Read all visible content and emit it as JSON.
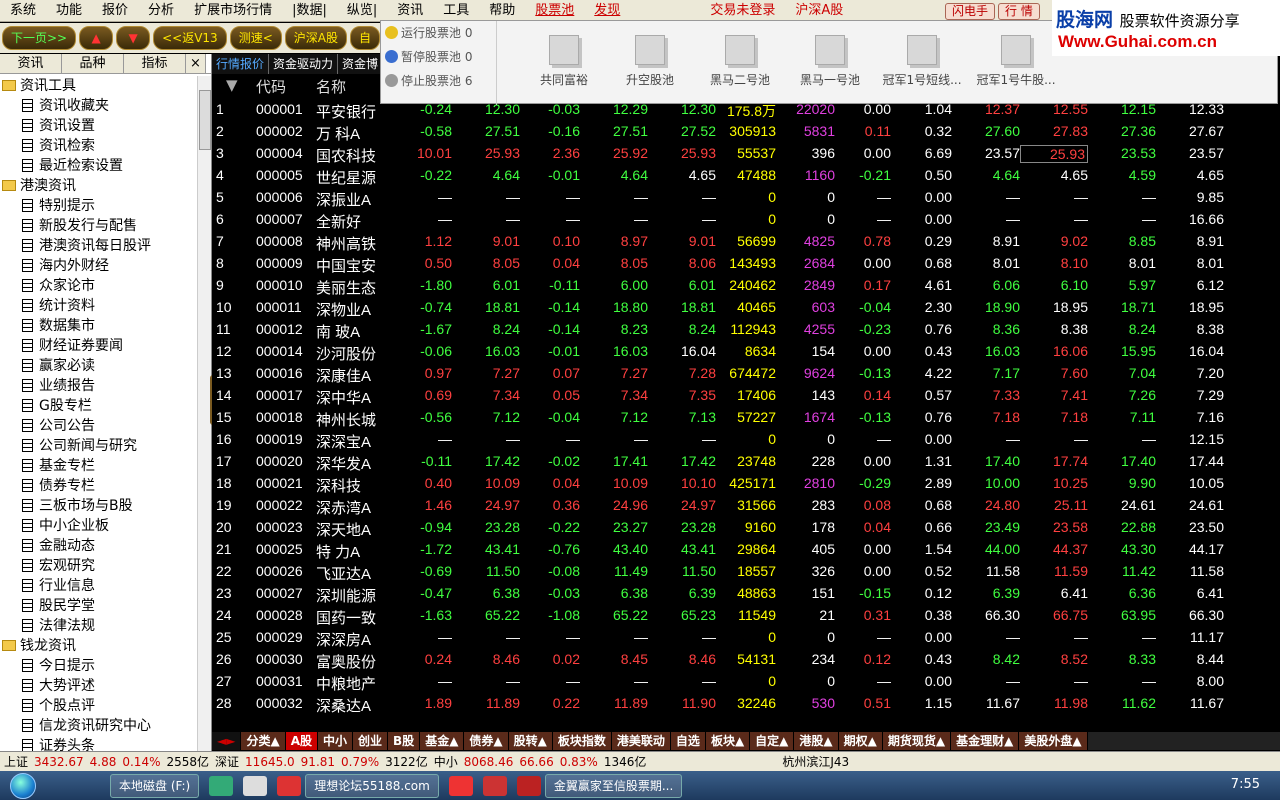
{
  "menu": {
    "items": [
      "系统",
      "功能",
      "报价",
      "分析",
      "扩展市场行情",
      "|数据|",
      "纵览|",
      "资讯",
      "工具",
      "帮助"
    ],
    "stock_pool": "股票池",
    "discover": "发现",
    "trade_status": "交易未登录",
    "market": "沪深A股",
    "btn_flash": "闪电手",
    "btn_quote": "行 情"
  },
  "logo": {
    "name": "股海网",
    "slogan": "股票软件资源分享",
    "url": "Www.Guhai.com.cn"
  },
  "toolbar": {
    "next_page": "下一页>>",
    "up": "▲",
    "down": "▼",
    "back": "<<返V13",
    "speed": "测速<",
    "market": "沪深A股",
    "self": "自"
  },
  "left": {
    "tabs": [
      "资讯",
      "品种",
      "指标",
      "×"
    ],
    "tree": [
      {
        "type": "folder",
        "label": "资讯工具"
      },
      {
        "type": "doc",
        "label": "资讯收藏夹"
      },
      {
        "type": "doc",
        "label": "资讯设置"
      },
      {
        "type": "doc",
        "label": "资讯检索"
      },
      {
        "type": "doc",
        "label": "最近检索设置"
      },
      {
        "type": "folder",
        "label": "港澳资讯"
      },
      {
        "type": "doc",
        "label": "特别提示"
      },
      {
        "type": "doc",
        "label": "新股发行与配售"
      },
      {
        "type": "doc",
        "label": "港澳资讯每日股评"
      },
      {
        "type": "doc",
        "label": "海内外财经"
      },
      {
        "type": "doc",
        "label": "众家论市"
      },
      {
        "type": "doc",
        "label": "统计资料"
      },
      {
        "type": "doc",
        "label": "数据集市"
      },
      {
        "type": "doc",
        "label": "财经证券要闻"
      },
      {
        "type": "doc",
        "label": "赢家必读"
      },
      {
        "type": "doc",
        "label": "业绩报告"
      },
      {
        "type": "doc",
        "label": "G股专栏"
      },
      {
        "type": "doc",
        "label": "公司公告"
      },
      {
        "type": "doc",
        "label": "公司新闻与研究"
      },
      {
        "type": "doc",
        "label": "基金专栏"
      },
      {
        "type": "doc",
        "label": "债券专栏"
      },
      {
        "type": "doc",
        "label": "三板市场与B股"
      },
      {
        "type": "doc",
        "label": "中小企业板"
      },
      {
        "type": "doc",
        "label": "金融动态"
      },
      {
        "type": "doc",
        "label": "宏观研究"
      },
      {
        "type": "doc",
        "label": "行业信息"
      },
      {
        "type": "doc",
        "label": "股民学堂"
      },
      {
        "type": "doc",
        "label": "法律法规"
      },
      {
        "type": "folder",
        "label": "钱龙资讯"
      },
      {
        "type": "doc",
        "label": "今日提示"
      },
      {
        "type": "doc",
        "label": "大势评述"
      },
      {
        "type": "doc",
        "label": "个股点评"
      },
      {
        "type": "doc",
        "label": "信龙资讯研究中心"
      },
      {
        "type": "doc",
        "label": "证券头条"
      }
    ]
  },
  "subtabs": [
    "行情报价",
    "资金驱动力",
    "资金博"
  ],
  "header": {
    "code": "代码",
    "name": "名称"
  },
  "popup": {
    "items": [
      {
        "label": "运行股票池 0",
        "color": "#e8c020"
      },
      {
        "label": "暂停股票池 0",
        "color": "#3a6ed0"
      },
      {
        "label": "停止股票池 6",
        "color": "#999"
      }
    ],
    "pools": [
      "共同富裕",
      "升空股池",
      "黑马二号池",
      "黑马一号池",
      "冠军1号短线...",
      "冠军1号牛股..."
    ]
  },
  "rows": [
    [
      "1",
      "000001",
      "平安银行",
      "-0.24",
      "12.30",
      "-0.03",
      "12.29",
      "12.30",
      "175.8万",
      "22020",
      "0.00",
      "1.04",
      "12.37",
      "12.55",
      "12.15",
      "12.33"
    ],
    [
      "2",
      "000002",
      "万 科A",
      "-0.58",
      "27.51",
      "-0.16",
      "27.51",
      "27.52",
      "305913",
      "5831",
      "0.11",
      "0.32",
      "27.60",
      "27.83",
      "27.36",
      "27.67"
    ],
    [
      "3",
      "000004",
      "国农科技",
      "10.01",
      "25.93",
      "2.36",
      "25.92",
      "25.93",
      "55537",
      "396",
      "0.00",
      "6.69",
      "23.57",
      "25.93",
      "23.53",
      "23.57"
    ],
    [
      "4",
      "000005",
      "世纪星源",
      "-0.22",
      "4.64",
      "-0.01",
      "4.64",
      "4.65",
      "47488",
      "1160",
      "-0.21",
      "0.50",
      "4.64",
      "4.65",
      "4.59",
      "4.65"
    ],
    [
      "5",
      "000006",
      "深振业A",
      "—",
      "—",
      "—",
      "—",
      "—",
      "0",
      "0",
      "—",
      "0.00",
      "—",
      "—",
      "—",
      "9.85"
    ],
    [
      "6",
      "000007",
      "全新好",
      "—",
      "—",
      "—",
      "—",
      "—",
      "0",
      "0",
      "—",
      "0.00",
      "—",
      "—",
      "—",
      "16.66"
    ],
    [
      "7",
      "000008",
      "神州高铁",
      "1.12",
      "9.01",
      "0.10",
      "8.97",
      "9.01",
      "56699",
      "4825",
      "0.78",
      "0.29",
      "8.91",
      "9.02",
      "8.85",
      "8.91"
    ],
    [
      "8",
      "000009",
      "中国宝安",
      "0.50",
      "8.05",
      "0.04",
      "8.05",
      "8.06",
      "143493",
      "2684",
      "0.00",
      "0.68",
      "8.01",
      "8.10",
      "8.01",
      "8.01"
    ],
    [
      "9",
      "000010",
      "美丽生态",
      "-1.80",
      "6.01",
      "-0.11",
      "6.00",
      "6.01",
      "240462",
      "2849",
      "0.17",
      "4.61",
      "6.06",
      "6.10",
      "5.97",
      "6.12"
    ],
    [
      "10",
      "000011",
      "深物业A",
      "-0.74",
      "18.81",
      "-0.14",
      "18.80",
      "18.81",
      "40465",
      "603",
      "-0.04",
      "2.30",
      "18.90",
      "18.95",
      "18.71",
      "18.95"
    ],
    [
      "11",
      "000012",
      "南 玻A",
      "-1.67",
      "8.24",
      "-0.14",
      "8.23",
      "8.24",
      "112943",
      "4255",
      "-0.23",
      "0.76",
      "8.36",
      "8.38",
      "8.24",
      "8.38"
    ],
    [
      "12",
      "000014",
      "沙河股份",
      "-0.06",
      "16.03",
      "-0.01",
      "16.03",
      "16.04",
      "8634",
      "154",
      "0.00",
      "0.43",
      "16.03",
      "16.06",
      "15.95",
      "16.04"
    ],
    [
      "13",
      "000016",
      "深康佳A",
      "0.97",
      "7.27",
      "0.07",
      "7.27",
      "7.28",
      "674472",
      "9624",
      "-0.13",
      "4.22",
      "7.17",
      "7.60",
      "7.04",
      "7.20"
    ],
    [
      "14",
      "000017",
      "深中华A",
      "0.69",
      "7.34",
      "0.05",
      "7.34",
      "7.35",
      "17406",
      "143",
      "0.14",
      "0.57",
      "7.33",
      "7.41",
      "7.26",
      "7.29"
    ],
    [
      "15",
      "000018",
      "神州长城",
      "-0.56",
      "7.12",
      "-0.04",
      "7.12",
      "7.13",
      "57227",
      "1674",
      "-0.13",
      "0.76",
      "7.18",
      "7.18",
      "7.11",
      "7.16"
    ],
    [
      "16",
      "000019",
      "深深宝A",
      "—",
      "—",
      "—",
      "—",
      "—",
      "0",
      "0",
      "—",
      "0.00",
      "—",
      "—",
      "—",
      "12.15"
    ],
    [
      "17",
      "000020",
      "深华发A",
      "-0.11",
      "17.42",
      "-0.02",
      "17.41",
      "17.42",
      "23748",
      "228",
      "0.00",
      "1.31",
      "17.40",
      "17.74",
      "17.40",
      "17.44"
    ],
    [
      "18",
      "000021",
      "深科技",
      "0.40",
      "10.09",
      "0.04",
      "10.09",
      "10.10",
      "425171",
      "2810",
      "-0.29",
      "2.89",
      "10.00",
      "10.25",
      "9.90",
      "10.05"
    ],
    [
      "19",
      "000022",
      "深赤湾A",
      "1.46",
      "24.97",
      "0.36",
      "24.96",
      "24.97",
      "31566",
      "283",
      "0.08",
      "0.68",
      "24.80",
      "25.11",
      "24.61",
      "24.61"
    ],
    [
      "20",
      "000023",
      "深天地A",
      "-0.94",
      "23.28",
      "-0.22",
      "23.27",
      "23.28",
      "9160",
      "178",
      "0.04",
      "0.66",
      "23.49",
      "23.58",
      "22.88",
      "23.50"
    ],
    [
      "21",
      "000025",
      "特 力A",
      "-1.72",
      "43.41",
      "-0.76",
      "43.40",
      "43.41",
      "29864",
      "405",
      "0.00",
      "1.54",
      "44.00",
      "44.37",
      "43.30",
      "44.17"
    ],
    [
      "22",
      "000026",
      "飞亚达A",
      "-0.69",
      "11.50",
      "-0.08",
      "11.49",
      "11.50",
      "18557",
      "326",
      "0.00",
      "0.52",
      "11.58",
      "11.59",
      "11.42",
      "11.58"
    ],
    [
      "23",
      "000027",
      "深圳能源",
      "-0.47",
      "6.38",
      "-0.03",
      "6.38",
      "6.39",
      "48863",
      "151",
      "-0.15",
      "0.12",
      "6.39",
      "6.41",
      "6.36",
      "6.41"
    ],
    [
      "24",
      "000028",
      "国药一致",
      "-1.63",
      "65.22",
      "-1.08",
      "65.22",
      "65.23",
      "11549",
      "21",
      "0.31",
      "0.38",
      "66.30",
      "66.75",
      "63.95",
      "66.30"
    ],
    [
      "25",
      "000029",
      "深深房A",
      "—",
      "—",
      "—",
      "—",
      "—",
      "0",
      "0",
      "—",
      "0.00",
      "—",
      "—",
      "—",
      "11.17"
    ],
    [
      "26",
      "000030",
      "富奥股份",
      "0.24",
      "8.46",
      "0.02",
      "8.45",
      "8.46",
      "54131",
      "234",
      "0.12",
      "0.43",
      "8.42",
      "8.52",
      "8.33",
      "8.44"
    ],
    [
      "27",
      "000031",
      "中粮地产",
      "—",
      "—",
      "—",
      "—",
      "—",
      "0",
      "0",
      "—",
      "0.00",
      "—",
      "—",
      "—",
      "8.00"
    ],
    [
      "28",
      "000032",
      "深桑达A",
      "1.89",
      "11.89",
      "0.22",
      "11.89",
      "11.90",
      "32246",
      "530",
      "0.51",
      "1.15",
      "11.67",
      "11.98",
      "11.62",
      "11.67"
    ]
  ],
  "bottomtabs": [
    "分类▲",
    "A股",
    "中小",
    "创业",
    "B股",
    "基金▲",
    "债券▲",
    "股转▲",
    "板块指数",
    "港美联动",
    "自选",
    "板块▲",
    "自定▲",
    "港股▲",
    "期权▲",
    "期货现货▲",
    "基金理财▲",
    "美股外盘▲"
  ],
  "status": {
    "sh_label": "上证",
    "sh_val": "3432.67",
    "sh_chg": "4.88",
    "sh_pct": "0.14%",
    "sh_amt": "2558亿",
    "sz_label": "深证",
    "sz_val": "11645.0",
    "sz_chg": "91.81",
    "sz_pct": "0.79%",
    "sz_amt": "3122亿",
    "zx_label": "中小",
    "zx_val": "8068.46",
    "zx_chg": "66.66",
    "zx_pct": "0.83%",
    "zx_amt": "1346亿",
    "server": "杭州滨江J43"
  },
  "taskbar": {
    "disk": "本地磁盘 (F:)",
    "forum": "理想论坛55188.com",
    "app": "金翼赢家至信股票期...",
    "clock": "7:55"
  }
}
